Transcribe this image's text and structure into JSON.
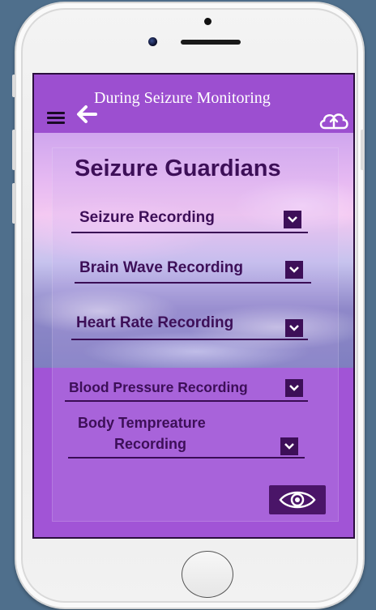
{
  "header": {
    "title": "During Seizure Monitoring"
  },
  "app": {
    "title": "Seizure Guardians"
  },
  "fields": [
    {
      "label": "Seizure Recording"
    },
    {
      "label": "Brain Wave Recording"
    },
    {
      "label": "Heart Rate Recording"
    },
    {
      "label": "Blood Pressure Recording"
    },
    {
      "label_line1": "Body Tempreature",
      "label_line2": "Recording"
    }
  ],
  "icons": {
    "menu": "hamburger-icon",
    "back": "back-arrow-icon",
    "upload": "cloud-upload-icon",
    "dropdown": "chevron-down-icon",
    "view": "eye-icon"
  },
  "colors": {
    "screen_bg": "#9c4fd0",
    "accent_dark": "#3d0f58",
    "button_bg": "#4a1568"
  }
}
